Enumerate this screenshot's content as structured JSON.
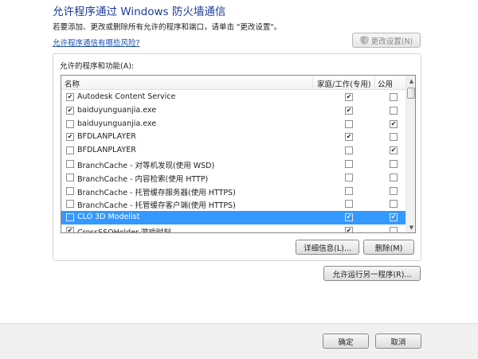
{
  "header": {
    "title": "允许程序通过 Windows 防火墙通信",
    "subtitle": "若要添加、更改或删除所有允许的程序和端口，请单击 \"更改设置\"。",
    "risk_link": "允许程序通信有哪些风险?",
    "change_settings_label": "更改设置(N)"
  },
  "group": {
    "label": "允许的程序和功能(A):",
    "columns": {
      "name": "名称",
      "home": "家庭/工作(专用)",
      "public": "公用"
    },
    "rows": [
      {
        "name": "Autodesk Content Service",
        "enabled": true,
        "home": true,
        "public": false
      },
      {
        "name": "baiduyunguanjia.exe",
        "enabled": true,
        "home": true,
        "public": false
      },
      {
        "name": "baiduyunguanjia.exe",
        "enabled": false,
        "home": false,
        "public": true
      },
      {
        "name": "BFDLANPLAYER",
        "enabled": true,
        "home": true,
        "public": false
      },
      {
        "name": "BFDLANPLAYER",
        "enabled": false,
        "home": false,
        "public": true
      },
      {
        "name": "BranchCache - 对等机发现(使用 WSD)",
        "enabled": false,
        "home": false,
        "public": false
      },
      {
        "name": "BranchCache - 内容检索(使用 HTTP)",
        "enabled": false,
        "home": false,
        "public": false
      },
      {
        "name": "BranchCache - 托管缓存服务器(使用 HTTPS)",
        "enabled": false,
        "home": false,
        "public": false
      },
      {
        "name": "BranchCache - 托管缓存客户端(使用 HTTPS)",
        "enabled": false,
        "home": false,
        "public": false
      },
      {
        "name": "CLO 3D Modelist",
        "enabled": false,
        "home": true,
        "public": true,
        "selected": true
      },
      {
        "name": "CrossSSOHolder-游戏时刻",
        "enabled": true,
        "home": true,
        "public": false
      }
    ],
    "details_label": "详细信息(L)...",
    "remove_label": "删除(M)"
  },
  "allow_other_label": "允许运行另一程序(R)...",
  "footer": {
    "ok_label": "确定",
    "cancel_label": "取消"
  },
  "colors": {
    "title": "#1f3b9b",
    "link": "#1a4fb5",
    "selection": "#3399ff"
  },
  "icons": {
    "change_settings": "uac-shield-icon",
    "check": "checkmark-icon"
  }
}
